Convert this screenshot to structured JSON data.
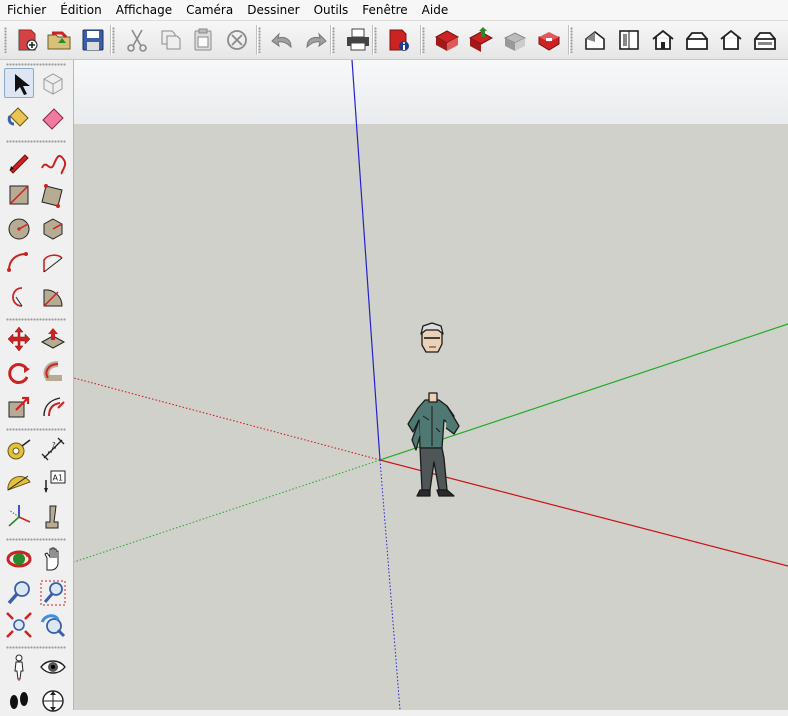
{
  "menu": [
    "Fichier",
    "Édition",
    "Affichage",
    "Caméra",
    "Dessiner",
    "Outils",
    "Fenêtre",
    "Aide"
  ],
  "toolbar": {
    "buttons": [
      "new-file-icon",
      "open-file-icon",
      "save-icon",
      "cut-icon",
      "copy-icon",
      "paste-icon",
      "erase-icon",
      "undo-icon",
      "redo-icon",
      "print-icon",
      "model-info-icon",
      "warehouse-get-models-icon",
      "warehouse-share-model-icon",
      "share-component-icon",
      "extension-warehouse-icon",
      "iso-view-icon",
      "top-view-icon",
      "front-view-icon",
      "right-view-icon",
      "back-view-icon",
      "left-view-icon"
    ]
  },
  "left_tools": [
    "select-tool-icon",
    "make-component-icon",
    "paint-bucket-icon",
    "eraser-icon",
    "line-tool-icon",
    "freehand-tool-icon",
    "rectangle-tool-icon",
    "rotated-rectangle-icon",
    "circle-tool-icon",
    "polygon-tool-icon",
    "arc-tool-icon",
    "two-point-arc-icon",
    "three-point-arc-icon",
    "pie-tool-icon",
    "move-tool-icon",
    "push-pull-icon",
    "rotate-tool-icon",
    "follow-me-icon",
    "scale-tool-icon",
    "offset-tool-icon",
    "tape-measure-icon",
    "dimension-tool-icon",
    "protractor-icon",
    "text-tool-icon",
    "axes-tool-icon",
    "3d-text-icon",
    "orbit-tool-icon",
    "pan-tool-icon",
    "zoom-tool-icon",
    "zoom-window-icon",
    "zoom-extents-icon",
    "previous-view-icon",
    "position-camera-icon",
    "look-around-icon",
    "walk-tool-icon",
    "section-plane-icon"
  ],
  "colors": {
    "sky": "#f2f4f5",
    "ground": "#d1d1cc",
    "axis_red": "#cc1111",
    "axis_green": "#22aa22",
    "axis_blue": "#2222cc",
    "accent_red": "#cc2222"
  }
}
